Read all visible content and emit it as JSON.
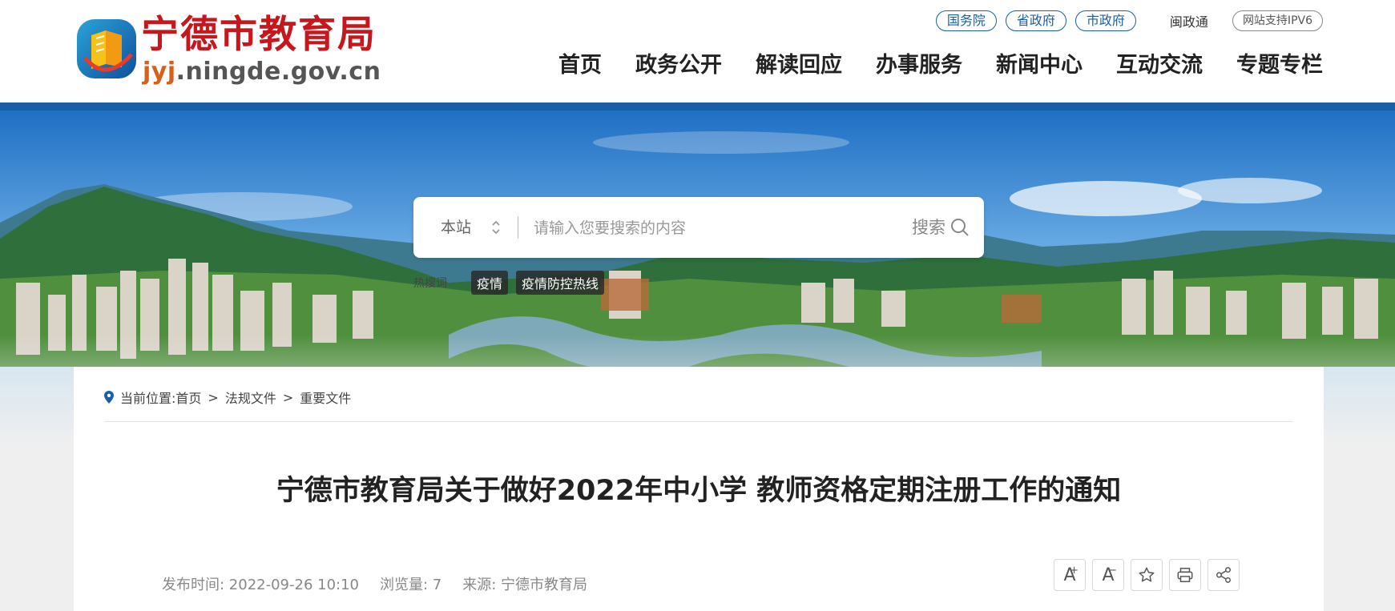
{
  "site": {
    "title": "宁德市教育局",
    "url_prefix": "jyj",
    "url_rest": ".ningde.gov.cn"
  },
  "top_links": {
    "gov_council": "国务院",
    "province": "省政府",
    "city": "市政府",
    "minzhengtong": "闽政通",
    "ipv6": "网站支持IPV6"
  },
  "nav": [
    "首页",
    "政务公开",
    "解读回应",
    "办事服务",
    "新闻中心",
    "互动交流",
    "专题专栏"
  ],
  "search": {
    "scope": "本站",
    "placeholder": "请输入您要搜索的内容",
    "button": "搜索",
    "hot_label": "热搜词",
    "hot_tags": [
      "疫情",
      "疫情防控热线"
    ]
  },
  "breadcrumb": {
    "label": "当前位置:",
    "items": [
      "首页",
      "法规文件",
      "重要文件"
    ],
    "separator": ">"
  },
  "article": {
    "title": "宁德市教育局关于做好2022年中小学 教师资格定期注册工作的通知",
    "publish": "发布时间: 2022-09-26 10:10",
    "views": "浏览量: 7",
    "source": "来源: 宁德市教育局"
  },
  "tools": {
    "font_up": "A",
    "font_up_sign": "+",
    "font_down": "A",
    "font_down_sign": "−"
  },
  "colors": {
    "brand_red": "#c8161d",
    "brand_blue": "#1a5ea8"
  }
}
